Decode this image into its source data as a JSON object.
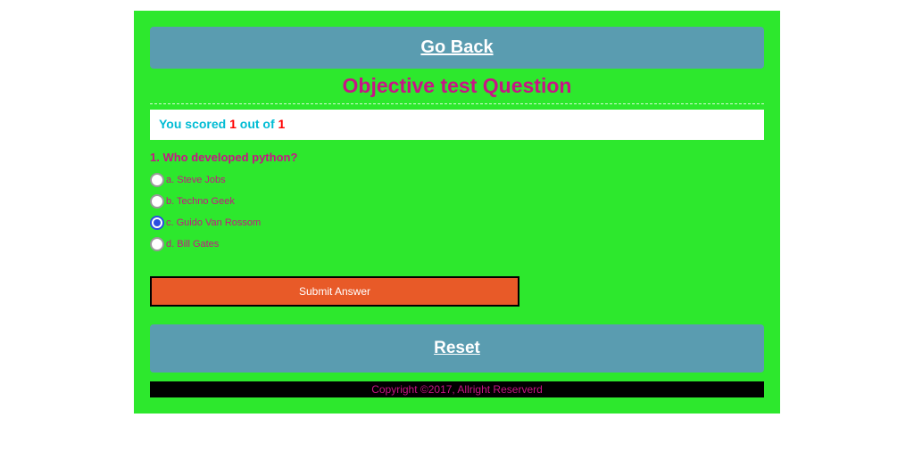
{
  "nav": {
    "go_back": "Go Back",
    "reset": "Reset"
  },
  "title": "Objective test Question",
  "score": {
    "prefix": "You scored ",
    "value": "1",
    "mid": " out of ",
    "total": "1"
  },
  "question": {
    "text": "1. Who developed python?",
    "options": {
      "a": "a. Steve Jobs",
      "b": "b. Techno Geek",
      "c": "c. Guido Van Rossom",
      "d": "d. Bill Gates"
    }
  },
  "buttons": {
    "submit": "Submit Answer"
  },
  "footer": "Copyright ©2017, Allright Reserverd"
}
